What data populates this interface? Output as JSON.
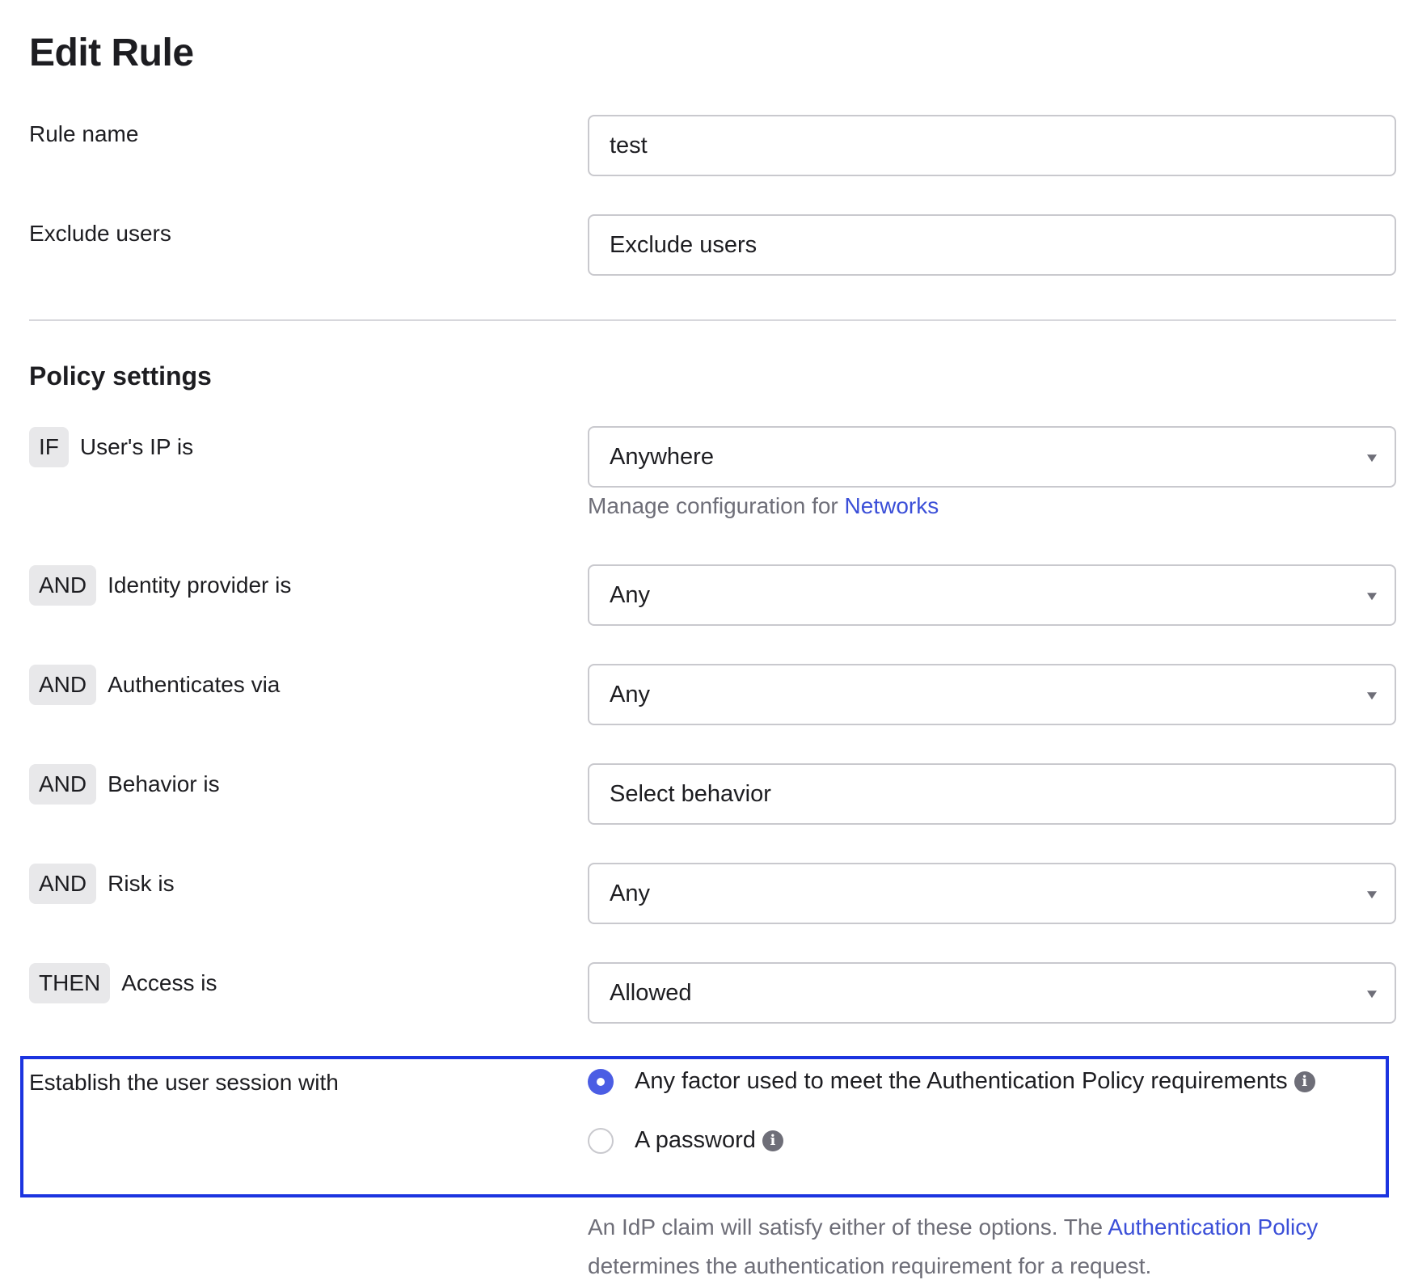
{
  "page": {
    "title": "Edit Rule"
  },
  "rule_name": {
    "label": "Rule name",
    "value": "test"
  },
  "exclude_users": {
    "label": "Exclude users",
    "value": "Exclude users"
  },
  "policy": {
    "title": "Policy settings",
    "conditions": [
      {
        "badge": "IF",
        "label": "User's IP is",
        "value": "Anywhere"
      },
      {
        "badge": "AND",
        "label": "Identity provider is",
        "value": "Any"
      },
      {
        "badge": "AND",
        "label": "Authenticates via",
        "value": "Any"
      },
      {
        "badge": "AND",
        "label": "Behavior is",
        "value": "Select behavior"
      },
      {
        "badge": "AND",
        "label": "Risk is",
        "value": "Any"
      },
      {
        "badge": "THEN",
        "label": "Access is",
        "value": "Allowed"
      }
    ],
    "network_hint": {
      "text": "Manage configuration for ",
      "link": "Networks"
    }
  },
  "session": {
    "label": "Establish the user session with",
    "options": [
      {
        "label": "Any factor used to meet the Authentication Policy requirements",
        "selected": true
      },
      {
        "label": "A password",
        "selected": false
      }
    ],
    "hint": {
      "text_before": "An IdP claim will satisfy either of these options. The ",
      "link": "Authentication Policy",
      "text_after": "determines the authentication requirement for a request."
    }
  },
  "colors": {
    "accent": "#4b5de4",
    "link": "#3b4fd8",
    "highlight": "#1c34e0"
  },
  "icons": {
    "info": "info-icon",
    "dropdown": "chevron-down-icon"
  }
}
